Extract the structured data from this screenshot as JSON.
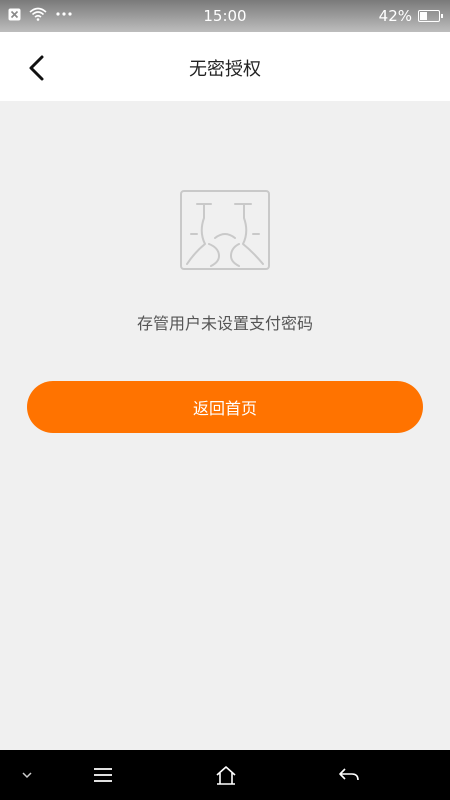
{
  "status_bar": {
    "time": "15:00",
    "battery_text": "42%",
    "battery_level": 0.42,
    "icons": [
      "close-box-icon",
      "wifi-icon",
      "more-dots-icon",
      "battery-icon"
    ]
  },
  "nav": {
    "title": "无密授权",
    "back_icon": "chevron-left-icon"
  },
  "content": {
    "illustration_icon": "crying-face-icon",
    "message": "存管用户未设置支付密码",
    "button_label": "返回首页",
    "accent_color": "#ff7300"
  },
  "system_nav": {
    "icons": [
      "chevron-down-icon",
      "menu-icon",
      "home-icon",
      "back-arrow-icon"
    ]
  }
}
